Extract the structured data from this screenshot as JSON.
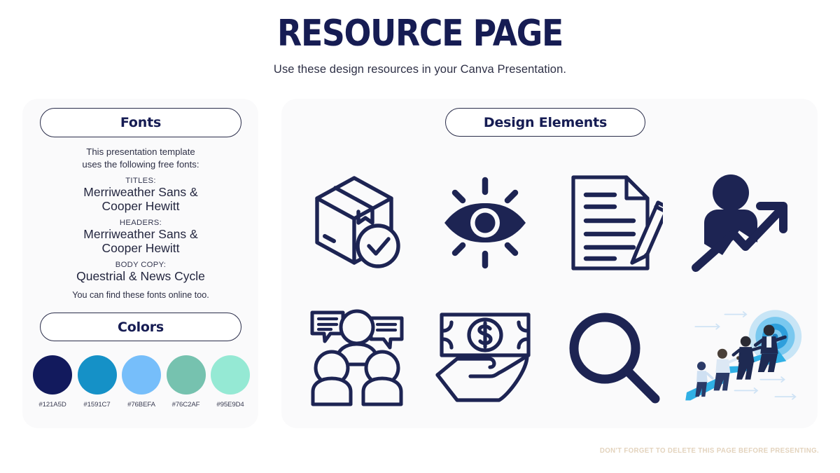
{
  "header": {
    "title": "RESOURCE PAGE",
    "subtitle": "Use these design resources in your Canva Presentation."
  },
  "fonts_panel": {
    "heading": "Fonts",
    "intro_line1": "This presentation template",
    "intro_line2": "uses the following free fonts:",
    "groups": [
      {
        "label": "TITLES:",
        "line1": "Merriweather Sans &",
        "line2": "Cooper Hewitt"
      },
      {
        "label": "HEADERS:",
        "line1": "Merriweather Sans &",
        "line2": "Cooper Hewitt"
      },
      {
        "label": "BODY COPY:",
        "line1": "Questrial & News Cycle",
        "line2": ""
      }
    ],
    "note": "You can find these fonts online too."
  },
  "colors_panel": {
    "heading": "Colors",
    "swatches": [
      {
        "hex_label": "#121A5D",
        "color": "#121A5D"
      },
      {
        "hex_label": "#1591C7",
        "color": "#1591C7"
      },
      {
        "hex_label": "#76BEFA",
        "color": "#76BEFA"
      },
      {
        "hex_label": "#76C2AF",
        "color": "#76C2AF"
      },
      {
        "hex_label": "#95E9D4",
        "color": "#95E9D4"
      }
    ]
  },
  "design_panel": {
    "heading": "Design Elements",
    "icons": [
      {
        "name": "package-check-icon"
      },
      {
        "name": "eye-vision-icon"
      },
      {
        "name": "document-pencil-icon"
      },
      {
        "name": "person-growth-arrow-icon"
      },
      {
        "name": "people-speech-bubbles-icon"
      },
      {
        "name": "hand-holding-money-icon"
      },
      {
        "name": "magnifying-glass-icon"
      },
      {
        "name": "team-climbing-arrow-target-illustration"
      }
    ]
  },
  "footer": {
    "note": "DON'T FORGET TO DELETE THIS PAGE BEFORE PRESENTING."
  },
  "theme": {
    "ink": "#161C53",
    "panel_bg": "#fafafb",
    "footer_color": "#e3d3bd",
    "illustration_cyan": "#29ABE2",
    "illustration_blue": "#1B5FA8"
  }
}
